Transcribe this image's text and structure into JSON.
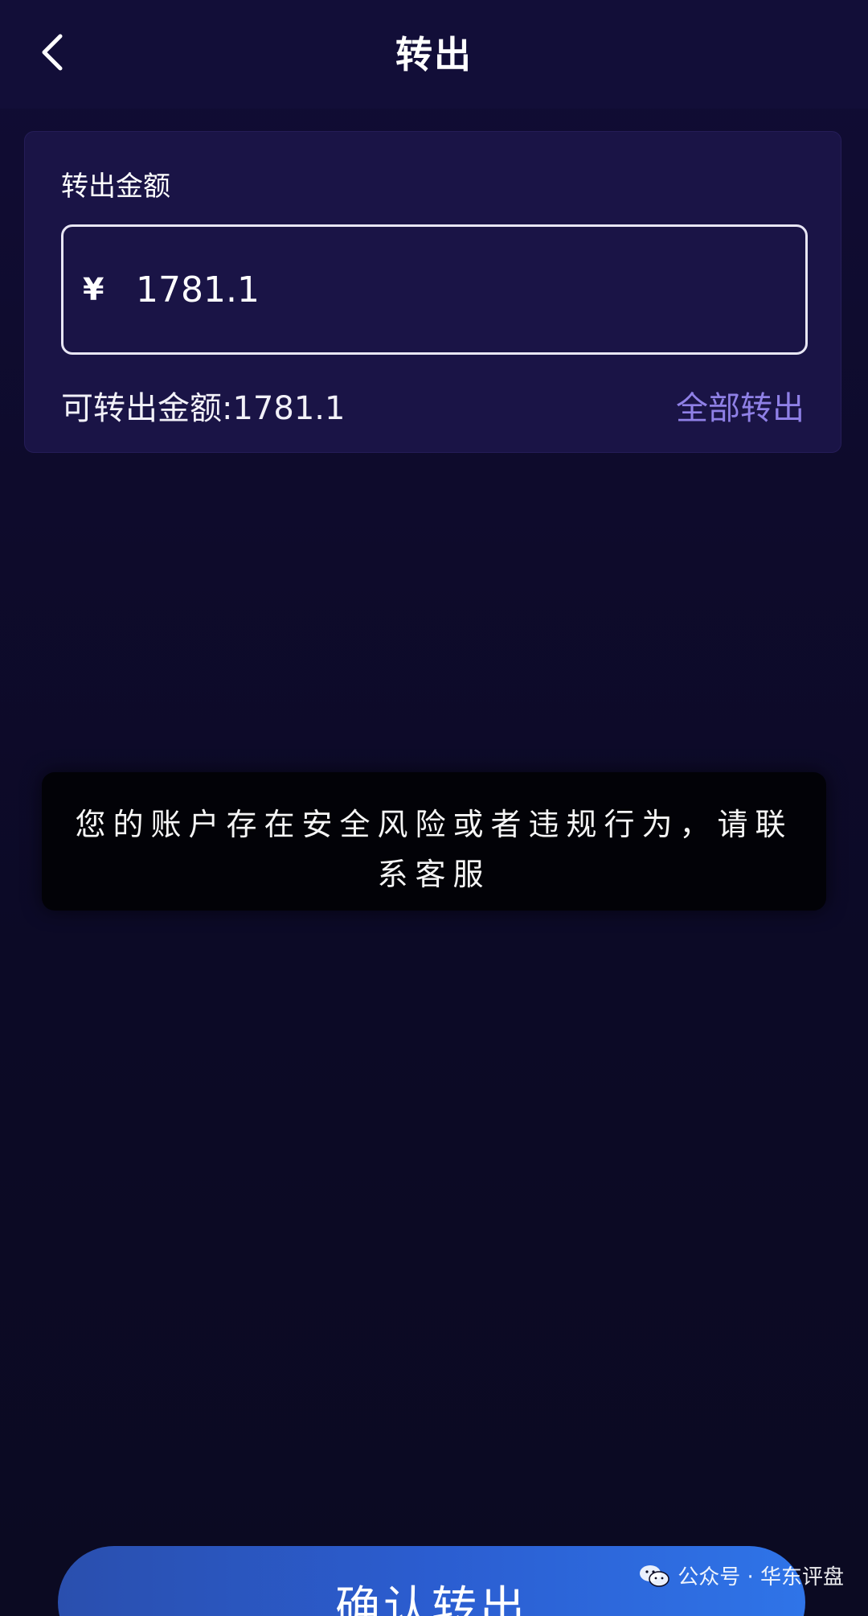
{
  "header": {
    "title": "转出",
    "back_icon": "chevron-left-icon"
  },
  "card": {
    "label": "转出金额",
    "currency_symbol": "¥",
    "amount_value": "1781.1",
    "available_label": "可转出金额:",
    "available_value": "1781.1",
    "transfer_all_label": "全部转出"
  },
  "toast": {
    "message": "您的账户存在安全风险或者违规行为，请联系客服"
  },
  "footer": {
    "confirm_label": "确认转出"
  },
  "watermark": {
    "text": "公众号 · 华东评盘",
    "icon": "wechat-icon"
  },
  "colors": {
    "background": "#0d0b26",
    "card": "#1a1446",
    "accent_link": "#8f80e6",
    "button": "#2b5dd0",
    "toast": "#020207"
  }
}
